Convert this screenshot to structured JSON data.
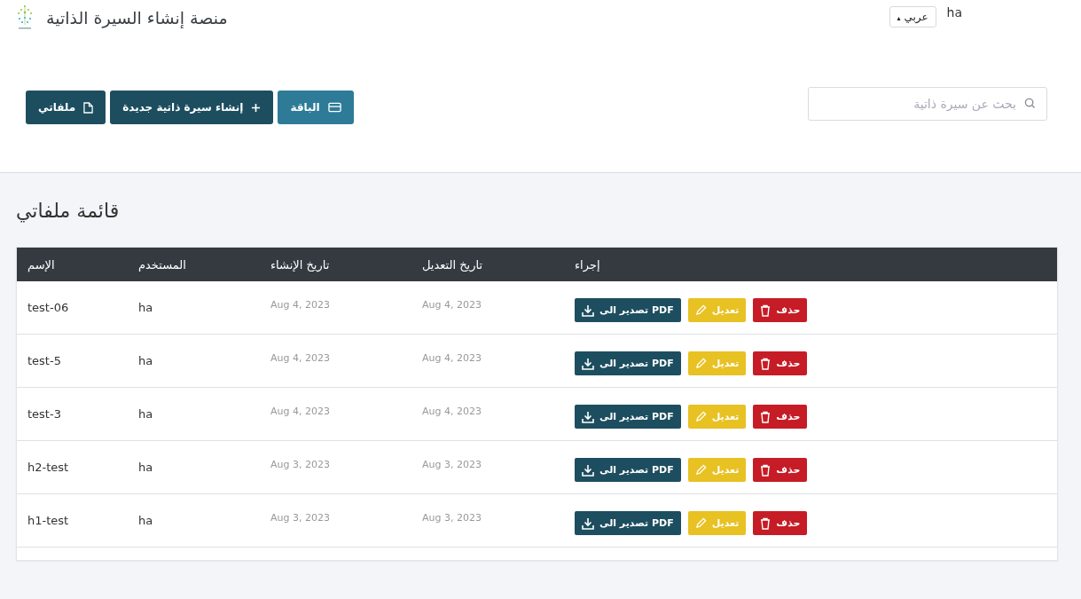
{
  "header": {
    "title": "منصة إنشاء السيرة الذاتية",
    "language": "عربي",
    "caret": "▴",
    "user": "ha"
  },
  "toolbar": {
    "buttons": [
      {
        "label": "الباقة",
        "kind": "plan"
      },
      {
        "label": "إنشاء سيرة ذاتية جديدة",
        "kind": "new"
      },
      {
        "label": "ملفاتي",
        "kind": "files"
      }
    ],
    "search": {
      "placeholder": "بحث عن سيرة ذاتية"
    }
  },
  "page_title": "قائمة ملفاتي",
  "table": {
    "columns": [
      "إجراء",
      "تاريخ التعديل",
      "تاريخ الإنشاء",
      "المستخدم",
      "الإسم"
    ],
    "rows": [
      {
        "modified": "Aug 4, 2023",
        "created": "Aug 4, 2023",
        "user": "ha",
        "name": "test-06",
        "actions": [
          {
            "label": "حذف",
            "kind": "delete"
          },
          {
            "label": "تعديل",
            "kind": "edit"
          },
          {
            "label": "تصدير الى PDF",
            "kind": "export"
          }
        ]
      },
      {
        "modified": "Aug 4, 2023",
        "created": "Aug 4, 2023",
        "user": "ha",
        "name": "test-5",
        "actions": [
          {
            "label": "حذف",
            "kind": "delete"
          },
          {
            "label": "تعديل",
            "kind": "edit"
          },
          {
            "label": "تصدير الى PDF",
            "kind": "export"
          }
        ]
      },
      {
        "modified": "Aug 4, 2023",
        "created": "Aug 4, 2023",
        "user": "ha",
        "name": "test-3",
        "actions": [
          {
            "label": "حذف",
            "kind": "delete"
          },
          {
            "label": "تعديل",
            "kind": "edit"
          },
          {
            "label": "تصدير الى PDF",
            "kind": "export"
          }
        ]
      },
      {
        "modified": "Aug 3, 2023",
        "created": "Aug 3, 2023",
        "user": "ha",
        "name": "h2-test",
        "actions": [
          {
            "label": "حذف",
            "kind": "delete"
          },
          {
            "label": "تعديل",
            "kind": "edit"
          },
          {
            "label": "تصدير الى PDF",
            "kind": "export"
          }
        ]
      },
      {
        "modified": "Aug 3, 2023",
        "created": "Aug 3, 2023",
        "user": "ha",
        "name": "h1-test",
        "actions": [
          {
            "label": "حذف",
            "kind": "delete"
          },
          {
            "label": "تعديل",
            "kind": "edit"
          },
          {
            "label": "تصدير الى PDF",
            "kind": "export"
          }
        ]
      }
    ]
  }
}
